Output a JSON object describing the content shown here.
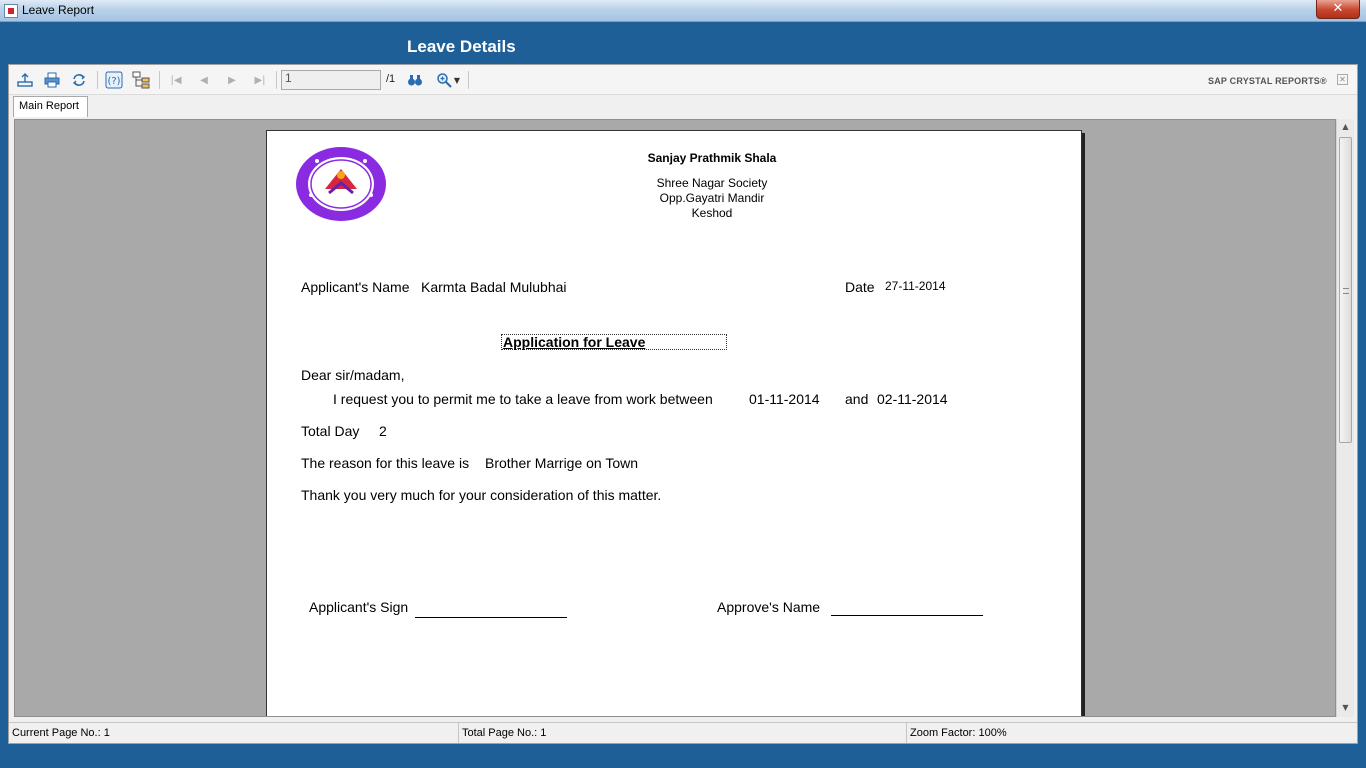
{
  "window": {
    "title": "Leave Report",
    "close_glyph": "✕"
  },
  "header": {
    "heading": "Leave Details"
  },
  "toolbar": {
    "page_input_value": "1",
    "page_total": "/1",
    "brand": "SAP CRYSTAL REPORTS®",
    "icons": [
      "export-icon",
      "print-icon",
      "refresh-icon",
      "help-icon",
      "group-tree-icon",
      "first-page-icon",
      "previous-page-icon",
      "next-page-icon",
      "last-page-icon",
      "find-icon",
      "zoom-icon"
    ]
  },
  "tabs": [
    {
      "label": "Main Report"
    }
  ],
  "report": {
    "school_name": "Sanjay Prathmik Shala",
    "address_line1": "Shree Nagar Society",
    "address_line2": "Opp.Gayatri Mandir",
    "address_line3": "Keshod",
    "applicant_label": "Applicant's Name",
    "applicant_name": "Karmta Badal Mulubhai",
    "date_label": "Date",
    "date_value": "27-11-2014",
    "subject": "Application for Leave",
    "salutation": "Dear sir/madam,",
    "request_text": "I request you to permit me to take a leave from work between",
    "from_date": "01-11-2014",
    "and_label": "and",
    "to_date": "02-11-2014",
    "total_day_label": "Total Day",
    "total_day_value": "2",
    "reason_label": "The reason for this leave is",
    "reason_value": "Brother Marrige on Town",
    "thanks": "Thank you very much for your consideration of this matter.",
    "applicant_sign_label": "Applicant's Sign",
    "approve_name_label": "Approve's Name"
  },
  "status": {
    "current_page": "Current Page No.: 1",
    "total_page": "Total Page No.: 1",
    "zoom": "Zoom Factor: 100%"
  },
  "colors": {
    "header_blue": "#1f5f98",
    "canvas_gray": "#a9a9a9",
    "logo_purple": "#8a2be2"
  }
}
